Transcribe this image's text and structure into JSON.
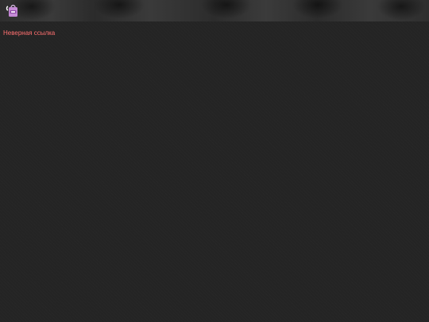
{
  "header": {
    "logo_icon": "shopping-bag-logo-icon"
  },
  "main": {
    "error_message": "Неверная ссылка"
  },
  "colors": {
    "background": "#242424",
    "error_text": "#ff7070",
    "logo_bag": "#c58ad6"
  }
}
